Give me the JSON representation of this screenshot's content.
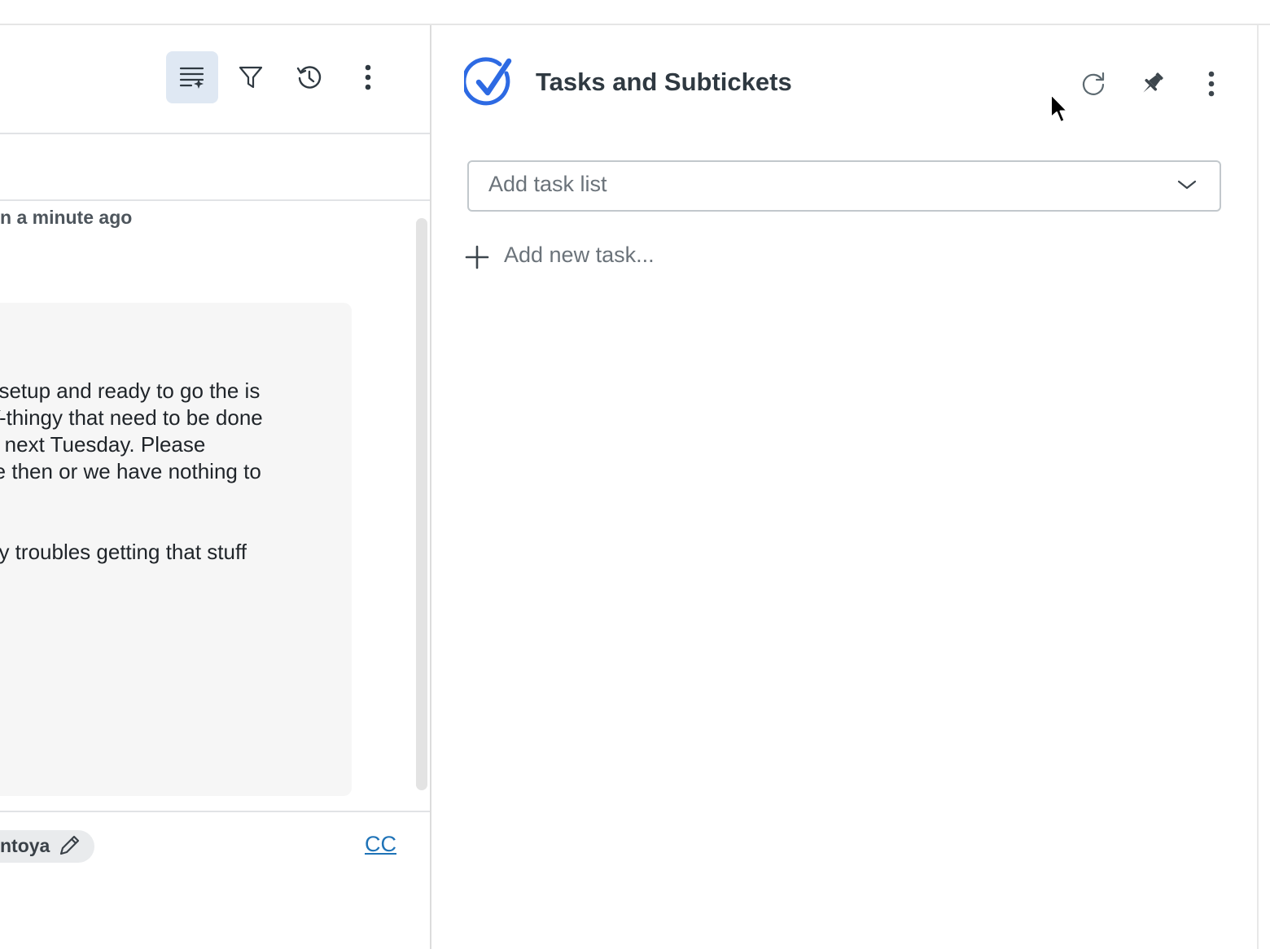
{
  "toolbar": {
    "active_icon": "list-sparkle-icon",
    "filter_icon": "filter-icon",
    "history_icon": "history-icon",
    "more_icon": "more-vertical-icon"
  },
  "conversation": {
    "timestamp": "n a minute ago",
    "message_lines": [
      "t setup and ready to go the is",
      " Y-thingy that need to be done",
      "e next Tuesday. Please",
      "re then or we have nothing to",
      "",
      "",
      "ny troubles getting that stuff"
    ],
    "assignee": "ntoya",
    "cc_label": "CC"
  },
  "tasks_panel": {
    "title": "Tasks and Subtickets",
    "select_placeholder": "Add task list",
    "add_task_label": "Add new task..."
  },
  "colors": {
    "brand_blue": "#1f73b7",
    "logo_blue": "#2d6ae3",
    "active_bg": "#dfe8f3"
  }
}
